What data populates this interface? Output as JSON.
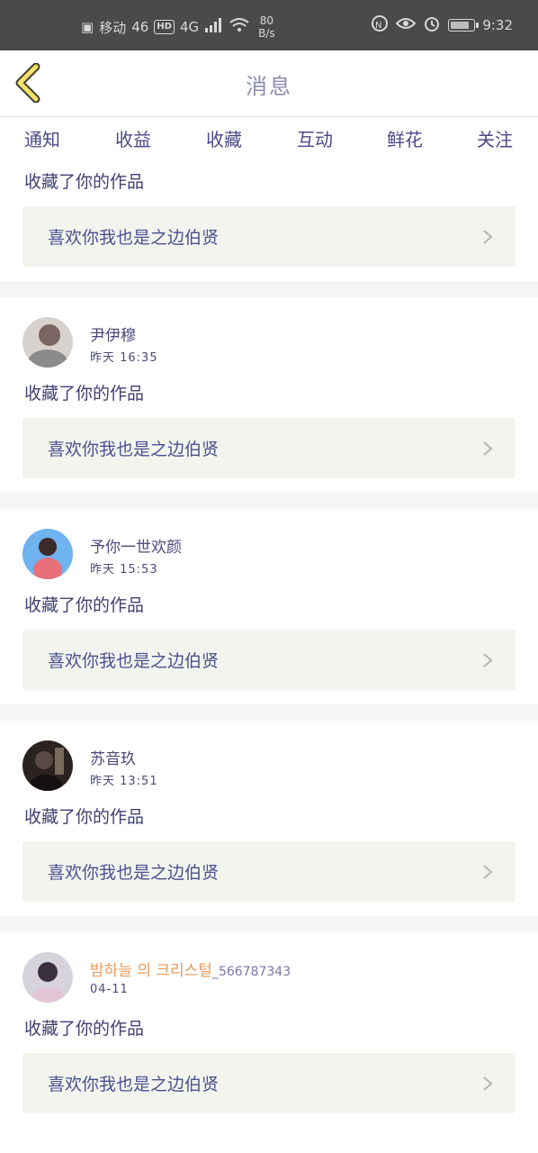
{
  "status_bar": {
    "carrier": "移动",
    "signal": "46",
    "hd": "HD",
    "net": "4G",
    "speed_value": "80",
    "speed_unit": "B/s",
    "time": "9:32"
  },
  "header": {
    "title": "消息"
  },
  "tabs": [
    {
      "label": "通知"
    },
    {
      "label": "收益"
    },
    {
      "label": "收藏",
      "active": true
    },
    {
      "label": "互动"
    },
    {
      "label": "鲜花"
    },
    {
      "label": "关注"
    }
  ],
  "feed": [
    {
      "action": "收藏了你的作品",
      "work": "喜欢你我也是之边伯贤"
    },
    {
      "name": "尹伊穆",
      "time": "昨天 16:35",
      "action": "收藏了你的作品",
      "work": "喜欢你我也是之边伯贤",
      "avatar_color": "#9a8a86"
    },
    {
      "name": "予你一世欢颜",
      "time": "昨天 15:53",
      "action": "收藏了你的作品",
      "work": "喜欢你我也是之边伯贤",
      "avatar_color": "#5aa0e8"
    },
    {
      "name": "苏音玖",
      "time": "昨天 13:51",
      "action": "收藏了你的作品",
      "work": "喜欢你我也是之边伯贤",
      "avatar_color": "#2b2320"
    },
    {
      "name": "밤하늘 의 크리스털",
      "name_suffix": "_566787343",
      "name_color": "#e89a5a",
      "time": "04-11",
      "action": "收藏了你的作品",
      "work": "喜欢你我也是之边伯贤",
      "avatar_color": "#c9c4cc"
    }
  ],
  "colors": {
    "accent": "#e36aa0",
    "back_arrow": "#f2e06a",
    "card_bg": "#f3f4ee"
  }
}
